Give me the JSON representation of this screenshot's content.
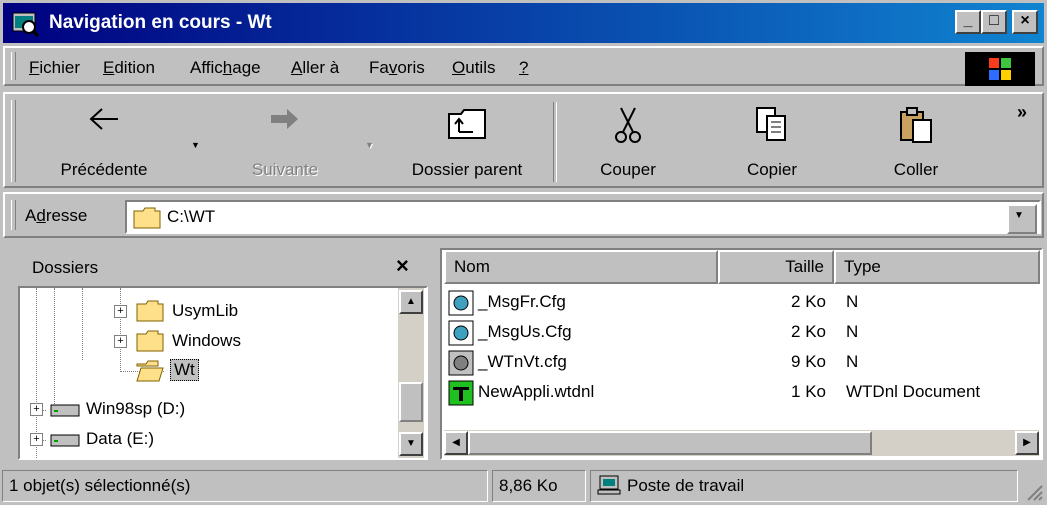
{
  "window": {
    "title": "Navigation en cours - Wt",
    "minimize": "_",
    "maximize": "□",
    "close": "×"
  },
  "menu": [
    {
      "pre": "",
      "key": "F",
      "post": "ichier"
    },
    {
      "pre": "",
      "key": "E",
      "post": "dition"
    },
    {
      "pre": "Affic",
      "key": "h",
      "post": "age"
    },
    {
      "pre": "",
      "key": "A",
      "post": "ller à"
    },
    {
      "pre": "Fa",
      "key": "v",
      "post": "oris"
    },
    {
      "pre": "",
      "key": "O",
      "post": "utils"
    },
    {
      "pre": "",
      "key": "?",
      "post": ""
    }
  ],
  "toolbar": {
    "back": "Précédente",
    "forward": "Suivante",
    "up": "Dossier parent",
    "cut": "Couper",
    "copy": "Copier",
    "paste": "Coller",
    "more": "»"
  },
  "address": {
    "label_pre": "A",
    "label_key": "d",
    "label_post": "resse",
    "value": "C:\\WT"
  },
  "folders": {
    "title": "Dossiers",
    "close": "×",
    "items": [
      {
        "label": "UsymLib",
        "expand": "+"
      },
      {
        "label": "Windows",
        "expand": "+"
      },
      {
        "label": "Wt",
        "expand": ""
      },
      {
        "label": "Win98sp (D:)",
        "expand": "+"
      },
      {
        "label": "Data (E:)",
        "expand": "+"
      }
    ]
  },
  "filelist": {
    "columns": {
      "name": "Nom",
      "size": "Taille",
      "type": "Type"
    },
    "rows": [
      {
        "name": "_MsgFr.Cfg",
        "size": "2 Ko",
        "type": "N",
        "icon": "cfg-icon"
      },
      {
        "name": "_MsgUs.Cfg",
        "size": "2 Ko",
        "type": "N",
        "icon": "cfg-icon"
      },
      {
        "name": "_WTnVt.cfg",
        "size": "9 Ko",
        "type": "N",
        "icon": "cfg-icon"
      },
      {
        "name": "NewAppli.wtdnl",
        "size": "1 Ko",
        "type": "WTDnl Document",
        "icon": "wtdnl-icon"
      }
    ]
  },
  "status": {
    "selection": "1 objet(s) sélectionné(s)",
    "size": "8,86 Ko",
    "zone": "Poste de travail"
  }
}
